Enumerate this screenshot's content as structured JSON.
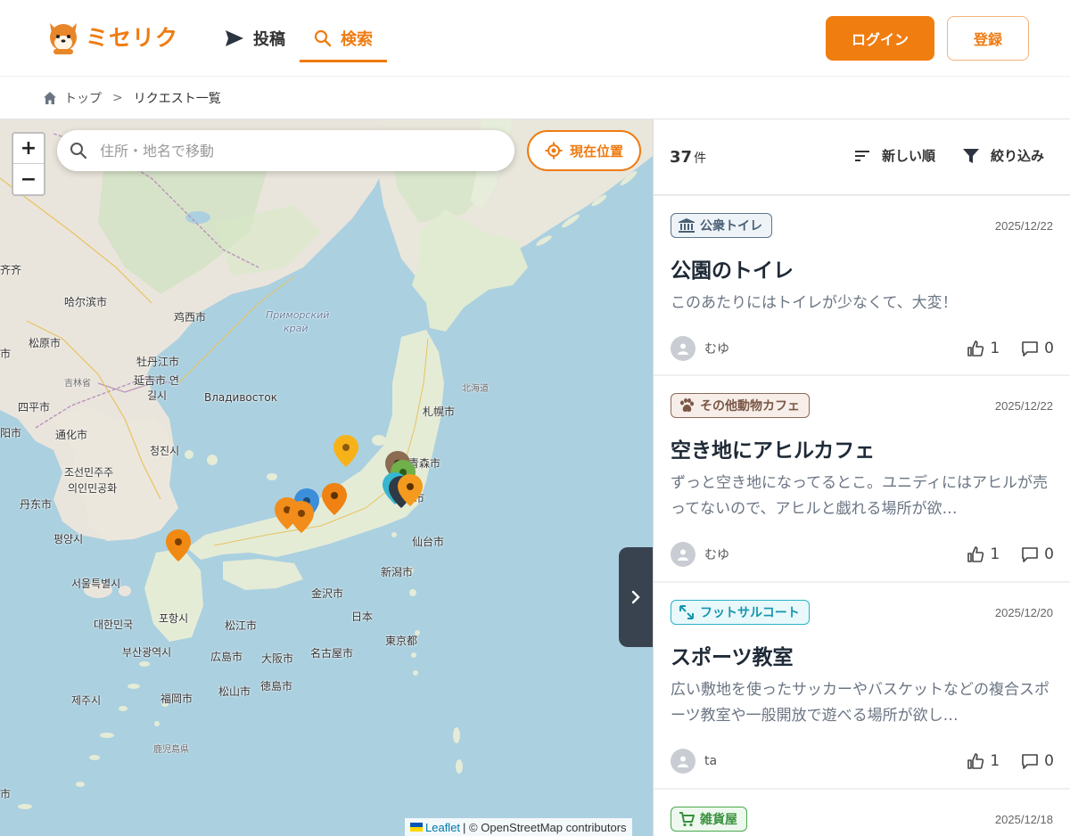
{
  "header": {
    "logo_text": "ミセリク",
    "nav": [
      {
        "label": "投稿",
        "icon": "send-icon"
      },
      {
        "label": "検索",
        "icon": "search-icon",
        "active": true
      }
    ],
    "login_label": "ログイン",
    "register_label": "登録",
    "accent_color": "#ef7b12"
  },
  "breadcrumb": {
    "home": "トップ",
    "separator": ">",
    "current": "リクエスト一覧"
  },
  "map": {
    "search_placeholder": "住所・地名で移動",
    "locate_label": "現在位置",
    "zoom_in": "+",
    "zoom_out": "−",
    "attribution_leaflet": "Leaflet",
    "attribution_rest": "| © OpenStreetMap contributors",
    "labels": {
      "harbin": "哈尔滨市",
      "jixi": "鸡西市",
      "primorsky": "Приморский",
      "krai": "край",
      "songyuan": "松原市",
      "mudanjiang": "牡丹江市",
      "yanji": "延吉市 연",
      "yanji2": "길시",
      "jilin": "吉林省",
      "vladivostok": "Владивосток",
      "siping": "四平市",
      "tonghua": "通化市",
      "shenyang": "沈阳市",
      "cheongjin": "청진시",
      "dprk1": "조선민주주",
      "dprk2": "의인민공화",
      "dandong": "丹东市",
      "pyongyang": "평양시",
      "seoul": "서울특별시",
      "korea": "대한민국",
      "pohang": "포항시",
      "busan": "부산광역시",
      "jeju": "제주시",
      "hokkaido": "北海道",
      "sapporo": "札幌市",
      "aomori": "青森市",
      "akita": "秋田市",
      "sendai": "仙台市",
      "niigata": "新潟市",
      "kanazawa": "金沢市",
      "japan": "日本",
      "matsue": "松江市",
      "hiroshima": "広島市",
      "osaka": "大阪市",
      "nagoya": "名古屋市",
      "tokyo": "東京都",
      "fukuoka": "福岡市",
      "matsuyama": "松山市",
      "tokushima": "徳島市",
      "kagoshima": "鹿児島県",
      "edge1": "齐齐",
      "edge2": "市",
      "edge3": "阳市",
      "edge4": "市"
    }
  },
  "list": {
    "count": "37",
    "count_unit": "件",
    "sort_label": "新しい順",
    "filter_label": "絞り込み",
    "cards": [
      {
        "tag": "公衆トイレ",
        "tag_icon": "bank-icon",
        "date": "2025/12/22",
        "title": "公園のトイレ",
        "desc": "このあたりにはトイレが少なくて、大変！",
        "author": "むゆ",
        "likes": "1",
        "comments": "0"
      },
      {
        "tag": "その他動物カフェ",
        "tag_icon": "paw-icon",
        "date": "2025/12/22",
        "title": "空き地にアヒルカフェ",
        "desc": "ずっと空き地になってるとこ。ユニディにはアヒルが売ってないので、アヒルと戯れる場所が欲…",
        "author": "むゆ",
        "likes": "1",
        "comments": "0"
      },
      {
        "tag": "フットサルコート",
        "tag_icon": "expand-icon",
        "date": "2025/12/20",
        "title": "スポーツ教室",
        "desc": "広い敷地を使ったサッカーやバスケットなどの複合スポーツ教室や一般開放で遊べる場所が欲し…",
        "author": "ta",
        "likes": "1",
        "comments": "0"
      },
      {
        "tag": "雑貨屋",
        "tag_icon": "cart-icon",
        "date": "2025/12/18"
      }
    ]
  }
}
